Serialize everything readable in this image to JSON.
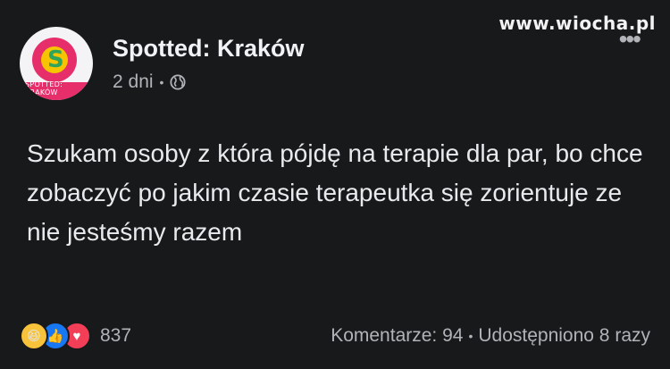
{
  "watermark": "www.wiocha.pl",
  "post": {
    "page_name": "Spotted: Kraków",
    "time_ago": "2 dni",
    "visibility_icon": "globe-icon",
    "avatar_band_text": "SPOTTED: KRAKÓW",
    "text": "Szukam osoby z która pójdę na terapie dla par, bo chce zobaczyć po jakim czasie terapeutka się zorientuje ze nie jesteśmy razem"
  },
  "footer": {
    "reaction_icons": [
      "haha-icon",
      "like-icon",
      "love-icon"
    ],
    "reaction_count": "837",
    "comments": "Komentarze: 94",
    "shares": "Udostępniono 8 razy"
  },
  "colors": {
    "background": "#18191a",
    "text_primary": "#e4e6eb",
    "text_secondary": "#b0b3b8",
    "like": "#1877f2",
    "love": "#f33e58",
    "haha": "#f7c33b"
  }
}
